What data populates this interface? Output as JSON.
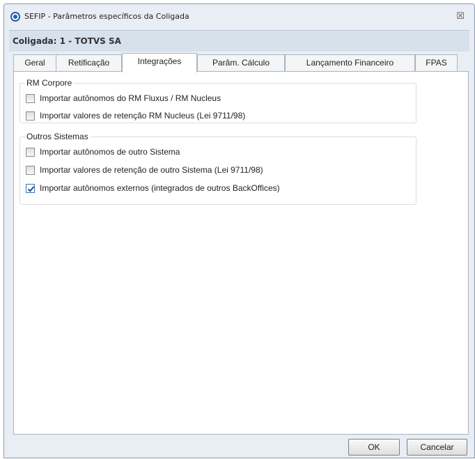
{
  "window": {
    "title": "SEFIP - Parâmetros específicos da Coligada",
    "close_glyph": "☒"
  },
  "company": {
    "label": "Coligada: 1 - TOTVS SA"
  },
  "tabs": [
    {
      "label": "Geral",
      "active": false
    },
    {
      "label": "Retificação",
      "active": false
    },
    {
      "label": "Integrações",
      "active": true
    },
    {
      "label": "Parâm. Cálculo",
      "active": false
    },
    {
      "label": "Lançamento Financeiro",
      "active": false
    },
    {
      "label": "FPAS",
      "active": false
    }
  ],
  "groups": {
    "rm_corpore": {
      "title": "RM Corpore",
      "items": [
        {
          "label": "Importar autônomos do RM Fluxus / RM Nucleus",
          "checked": false
        },
        {
          "label": "Importar valores de retenção RM Nucleus (Lei 9711/98)",
          "checked": false
        }
      ]
    },
    "outros": {
      "title": "Outros Sistemas",
      "items": [
        {
          "label": "Importar autônomos de outro Sistema",
          "checked": false
        },
        {
          "label": "Importar valores de retenção de outro Sistema  (Lei 9711/98)",
          "checked": false
        },
        {
          "label": "Importar autônomos externos (integrados de outros BackOffices)",
          "checked": true
        }
      ]
    }
  },
  "buttons": {
    "ok": "OK",
    "cancel": "Cancelar"
  },
  "colors": {
    "accent": "#3c6fb4",
    "window_bg": "#e9eef4"
  }
}
